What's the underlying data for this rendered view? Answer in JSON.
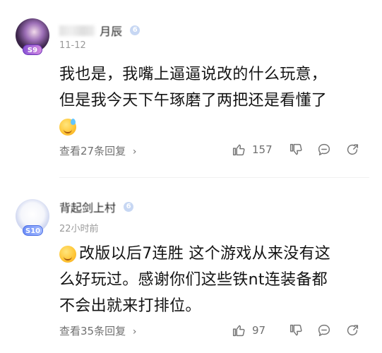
{
  "comments": [
    {
      "user_name_visible": "月辰",
      "level_badge": "S9",
      "verify_badge": "6",
      "time": "11-12",
      "body_lines": [
        "我也是，我嘴上逼逼说改的什么玩意，",
        "但是我今天下午琢磨了两把还是看懂了"
      ],
      "emoji": "sweat-smile-emoji",
      "replies_label": "查看27条回复",
      "like_count": "157"
    },
    {
      "user_name_visible": "背起剑上村",
      "level_badge": "S10",
      "verify_badge": "6",
      "time": "22小时前",
      "body_lines": [
        "改版以后7连胜 这个游戏从来没有这",
        "么好玩过。感谢你们这些铁nt连装备都",
        "不会出就来打排位。"
      ],
      "emoji": "yum-emoji",
      "replies_label": "查看35条回复",
      "like_count": "97"
    }
  ]
}
